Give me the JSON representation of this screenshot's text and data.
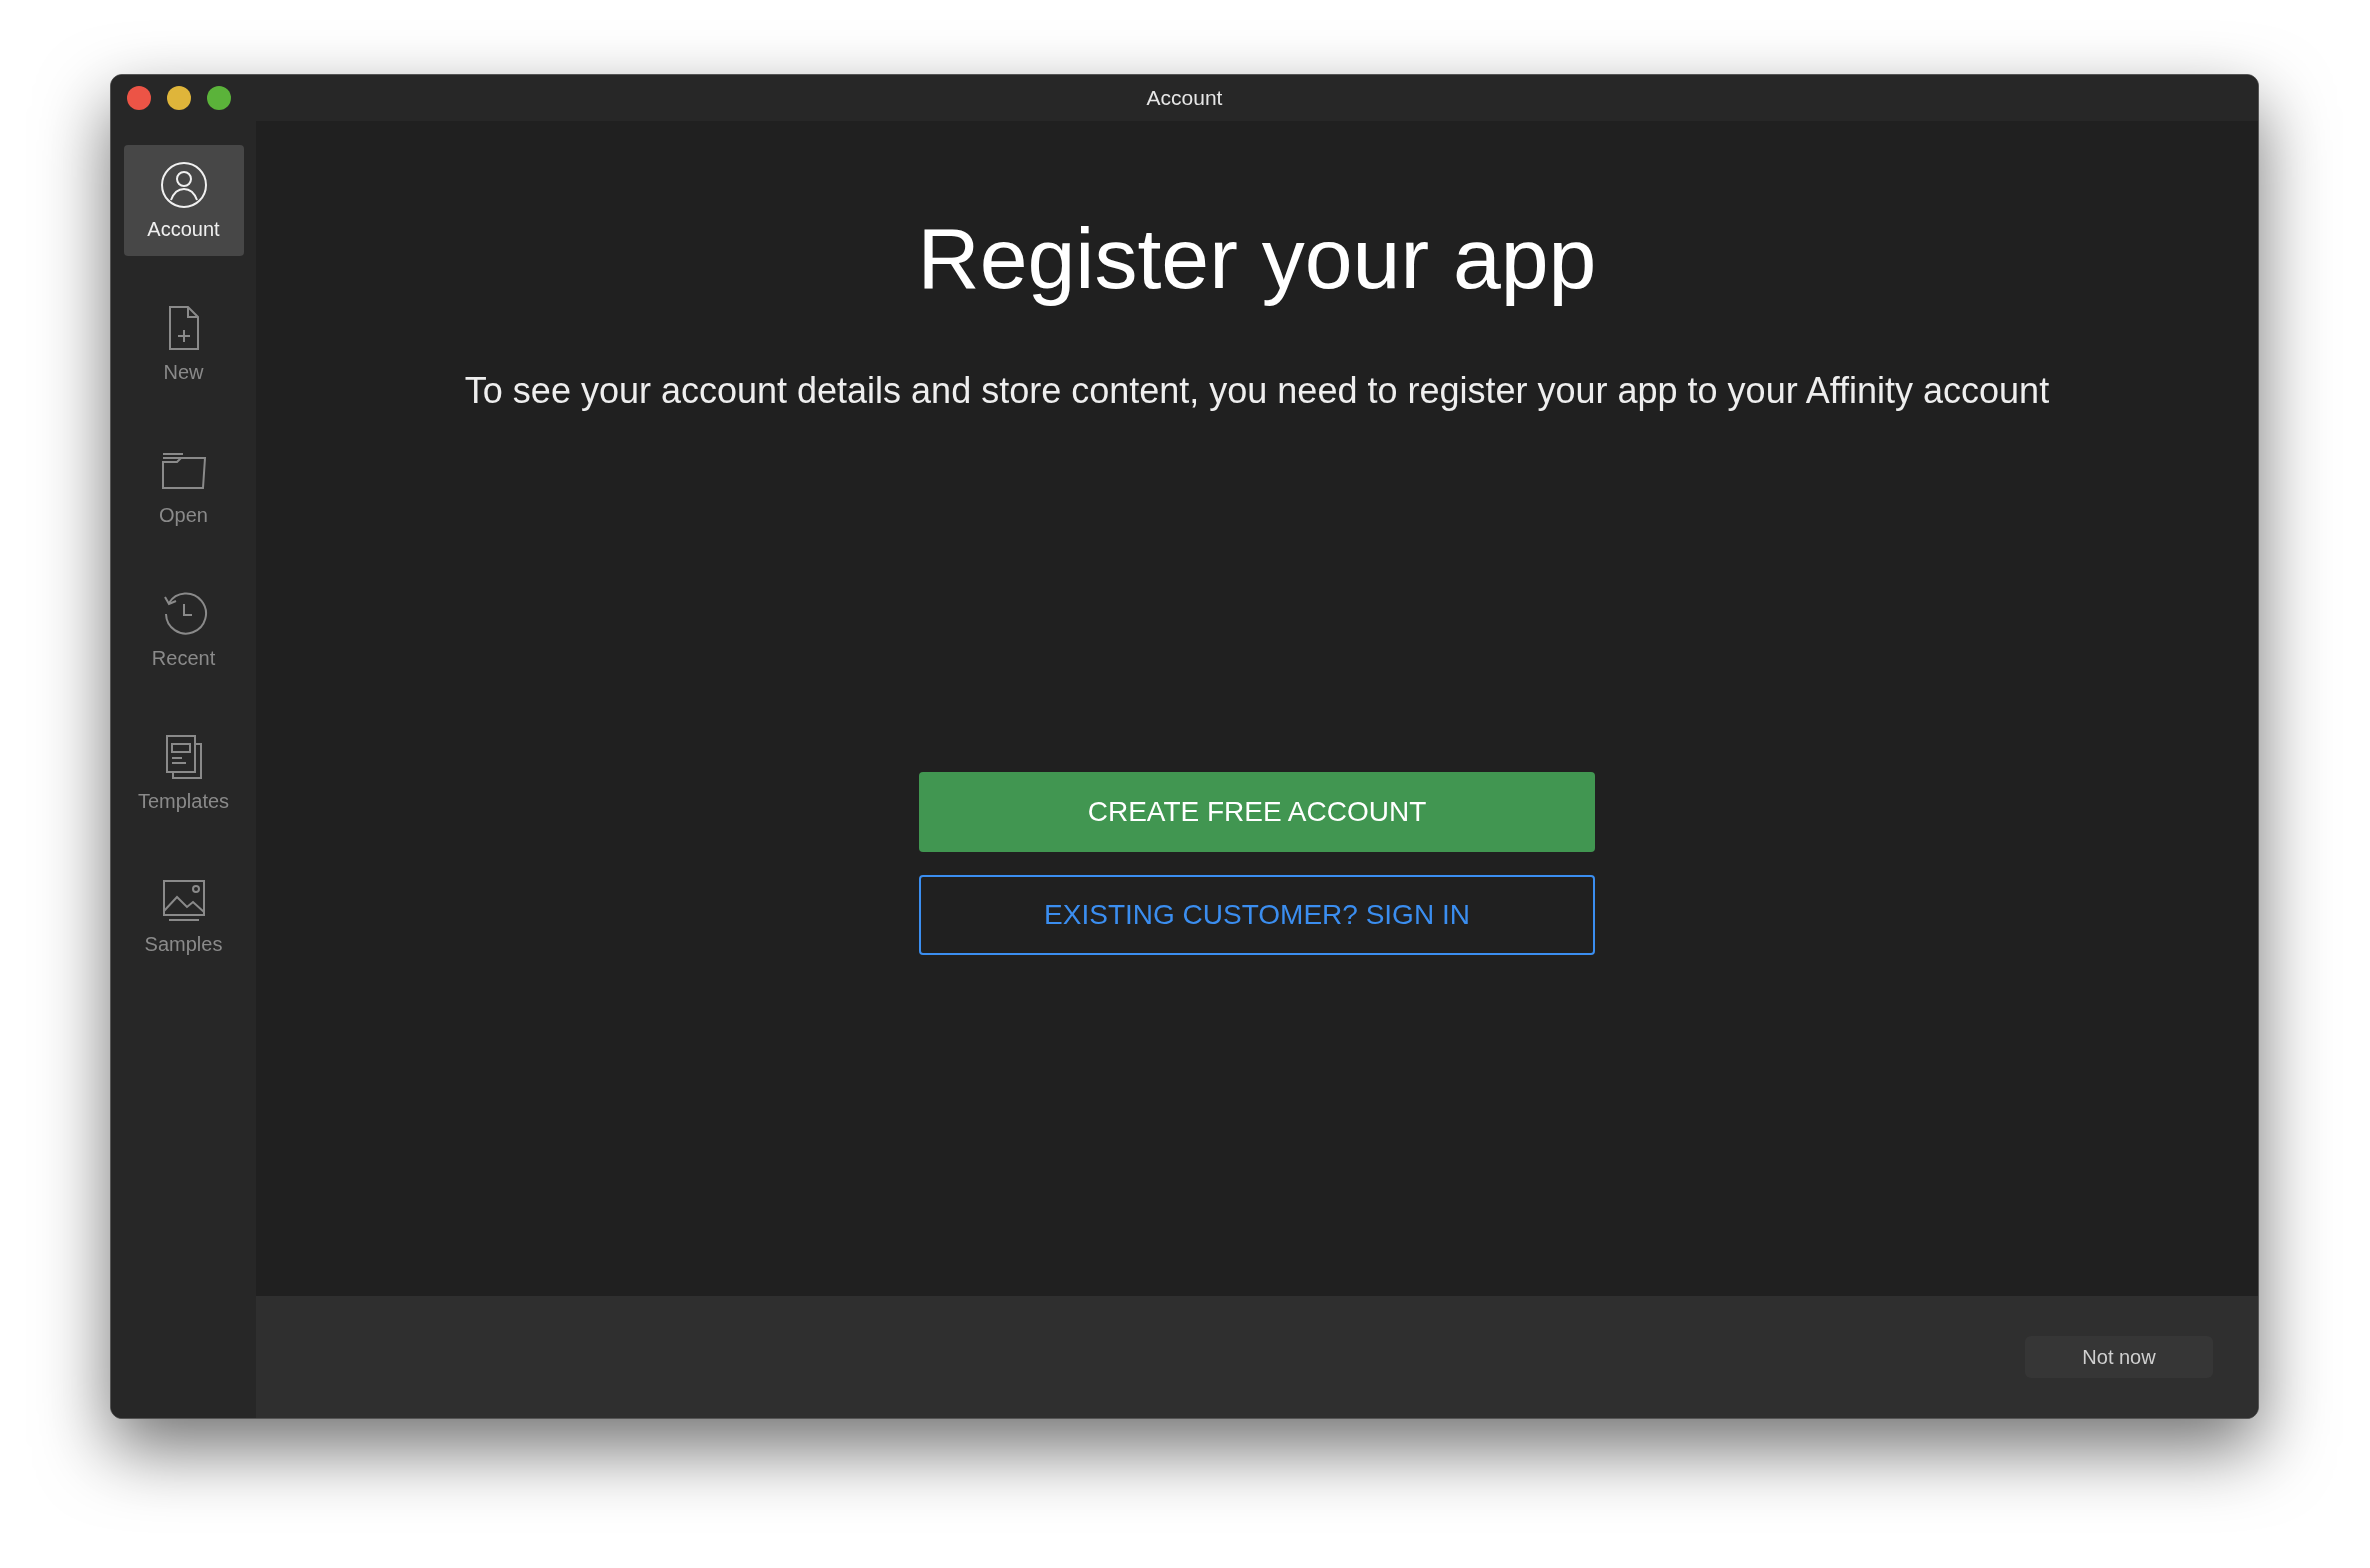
{
  "window": {
    "title": "Account"
  },
  "sidebar": {
    "items": [
      {
        "kind": "account",
        "label": "Account",
        "selected": true
      },
      {
        "kind": "new",
        "label": "New",
        "selected": false
      },
      {
        "kind": "open",
        "label": "Open",
        "selected": false
      },
      {
        "kind": "recent",
        "label": "Recent",
        "selected": false
      },
      {
        "kind": "templates",
        "label": "Templates",
        "selected": false
      },
      {
        "kind": "samples",
        "label": "Samples",
        "selected": false
      }
    ]
  },
  "main": {
    "heading": "Register your app",
    "message": "To see your account details and store content, you need to register your app to your Affinity account",
    "buttons": [
      {
        "kind": "primary",
        "label": "CREATE FREE ACCOUNT"
      },
      {
        "kind": "outline",
        "label": "EXISTING CUSTOMER? SIGN IN"
      }
    ]
  },
  "footer": {
    "button": "Not now"
  }
}
